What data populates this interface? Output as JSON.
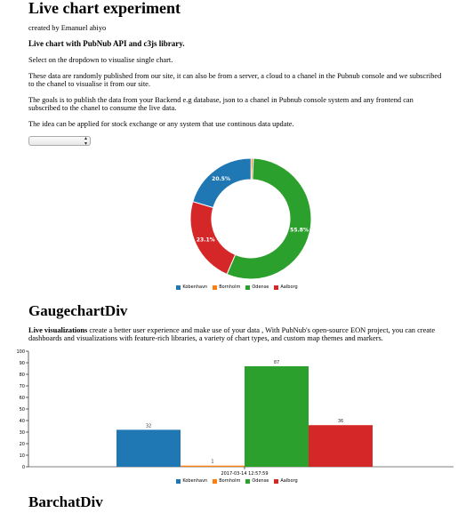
{
  "header": {
    "title": "Live chart experiment",
    "byline": "created by Emanuel abiyo",
    "subtitle": "Live chart with PubNub API and c3js library.",
    "para1": "Select on the dropdown to visualise single chart.",
    "para2": "These data are randomly published from our site, it can also be from a server, a cloud to a chanel in the Pubnub console and we subscribed to the chanel to visualise it from our site.",
    "para3": "The goals is to publish the data from your Backend e.g database, json to a chanel in Pubnub console system and any frontend can subscribed to the chanel to consume the live data.",
    "para4": "The idea can be applied for stock exchange or any system that use continous data update."
  },
  "dropdown": {
    "selected": ""
  },
  "colors": {
    "blue": "#1f77b4",
    "orange": "#ff7f0e",
    "green": "#2ca02c",
    "red": "#d62728"
  },
  "gauge_section": {
    "title": "GaugechartDiv",
    "lead_bold": "Live visualizations",
    "lead_rest": " create a better user experience and make use of your data , With PubNub's open-source EON project, you can create dashboards and visualizations with feature-rich libraries, a variety of chart types, and custom map themes and markers."
  },
  "bar_section": {
    "title": "BarchatDiv"
  },
  "chart_data": [
    {
      "type": "pie",
      "subtype": "donut",
      "categories": [
        "Kobenhavn",
        "Bornholm",
        "Odense",
        "Aalborg"
      ],
      "values": [
        20.5,
        0.6,
        55.8,
        23.1
      ],
      "labels": [
        "20.5%",
        "",
        "55.8%",
        "23.1%"
      ],
      "legend": [
        "Kobenhavn",
        "Bornholm",
        "Odense",
        "Aalborg"
      ]
    },
    {
      "type": "bar",
      "x": "2017-03-14 12:57:59",
      "series": [
        {
          "name": "Kobenhavn",
          "values": [
            32
          ]
        },
        {
          "name": "Bornholm",
          "values": [
            1
          ]
        },
        {
          "name": "Odense",
          "values": [
            87
          ]
        },
        {
          "name": "Aalborg",
          "values": [
            36
          ]
        }
      ],
      "data_labels": [
        "32",
        "1",
        "87",
        "36"
      ],
      "ylim": [
        0,
        100
      ],
      "yticks": [
        "0",
        "10",
        "20",
        "30",
        "40",
        "50",
        "60",
        "70",
        "80",
        "90",
        "100"
      ],
      "legend": [
        "Kobenhavn",
        "Bornholm",
        "Odense",
        "Aalborg"
      ]
    }
  ]
}
